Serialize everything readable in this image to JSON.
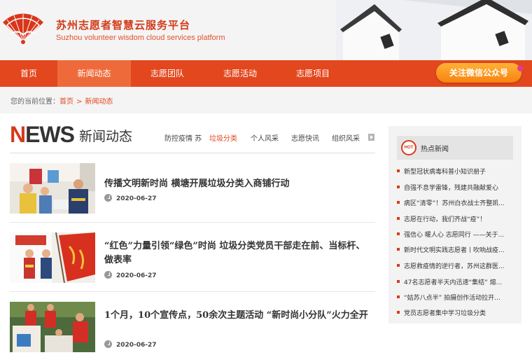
{
  "header": {
    "title_cn": "苏州志愿者智慧云服务平台",
    "title_en": "Suzhou volunteer wisdom cloud services platform"
  },
  "nav": {
    "items": [
      {
        "label": "首页"
      },
      {
        "label": "新闻动态"
      },
      {
        "label": "志愿团队"
      },
      {
        "label": "志愿活动"
      },
      {
        "label": "志愿项目"
      }
    ],
    "active_index": 1,
    "wechat_button": "关注微信公众号"
  },
  "breadcrumb": {
    "prefix": "您的当前位置：",
    "home": "首页",
    "separator": ">",
    "current": "新闻动态"
  },
  "section": {
    "logo_n": "N",
    "logo_rest": "EWS",
    "title_cn": "新闻动态",
    "tabs": [
      "防控疫情 苏",
      "垃圾分类",
      "个人风采",
      "志愿快讯",
      "组织风采"
    ],
    "active_tab": 1
  },
  "news": [
    {
      "title": "传播文明新时尚 横塘开展垃圾分类入商铺行动",
      "date": "2020-06-27"
    },
    {
      "title": "“红色”力量引领“绿色”时尚 垃圾分类党员干部走在前、当标杆、做表率",
      "date": "2020-06-27"
    },
    {
      "title": "1个月，10个宣传点，50余次主题活动 “新时尚小分队”火力全开",
      "date": "2020-06-27"
    }
  ],
  "sidebar": {
    "hot_icon_text": "HOT",
    "title": "热点新闻",
    "items": [
      "新型冠状病毒科普小知识册子",
      "自强不息学雷锋，残建共融献爱心",
      "病区“清零”！苏州白衣战士齐整凯...",
      "志愿在行动，我们齐战“疫”！",
      "强信心 暖人心 志愿同行 ——关于...",
      "新时代文明实践志愿者丨吹响战疫...",
      "志愿救疫情的逆行者，苏州这群医...",
      "47名志愿者半天内迅速“集结” 熔...",
      "“姑苏八点半” 拍摄创作活动拉开...",
      "党员志愿者集中学习垃圾分类"
    ]
  },
  "colors": {
    "brand_red": "#e2471e",
    "nav_active": "#ef6a3b",
    "wechat_orange": "#f7820f"
  },
  "icons": [
    "fan-logo-icon",
    "clock-icon",
    "hot-icon",
    "next-arrow-icon",
    "bullet-icon"
  ]
}
